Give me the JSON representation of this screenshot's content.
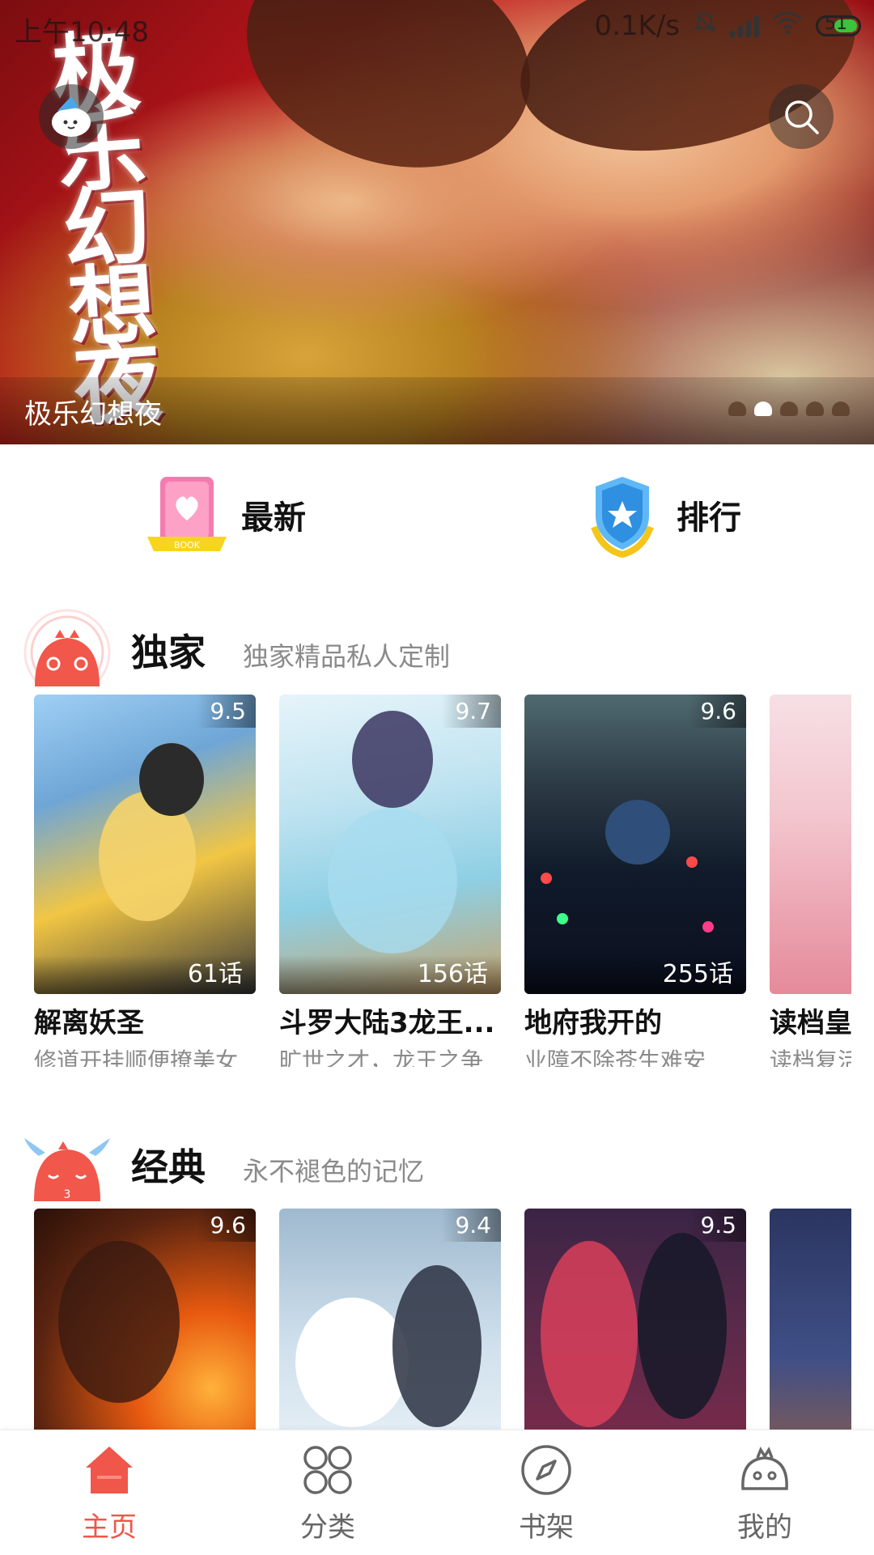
{
  "status_bar": {
    "time": "上午10:48",
    "net_speed": "0.1K/s",
    "battery": "51"
  },
  "banner": {
    "art_title": "极乐幻想夜",
    "caption": "极乐幻想夜",
    "dots": 5,
    "active_dot": 1
  },
  "quick_entries": {
    "new_label": "最新",
    "rank_label": "排行",
    "book_badge": "BOOK"
  },
  "sections": [
    {
      "title": "独家",
      "subtitle": "独家精品私人定制",
      "items": [
        {
          "score": "9.5",
          "eps": "61话",
          "name": "解离妖圣",
          "desc": "修道开挂顺便撩美女",
          "color": "#6fa6d6"
        },
        {
          "score": "9.7",
          "eps": "156话",
          "name": "斗罗大陆3龙王...",
          "desc": "旷世之才，龙王之争",
          "color": "#bfe3f0"
        },
        {
          "score": "9.6",
          "eps": "255话",
          "name": "地府我开的",
          "desc": "业障不除苍生难安",
          "color": "#1c2a3a"
        },
        {
          "score": "",
          "eps": "",
          "name": "读档皇",
          "desc": "读档复活",
          "color": "#f3c6cf"
        }
      ]
    },
    {
      "title": "经典",
      "subtitle": "永不褪色的记忆",
      "items": [
        {
          "score": "9.6",
          "eps": "",
          "name": "",
          "desc": "",
          "color": "#5a2410"
        },
        {
          "score": "9.4",
          "eps": "",
          "name": "",
          "desc": "",
          "color": "#cfe0ec"
        },
        {
          "score": "9.5",
          "eps": "",
          "name": "",
          "desc": "",
          "color": "#5b2a4a"
        },
        {
          "score": "",
          "eps": "",
          "name": "",
          "desc": "",
          "color": "#2b3560"
        }
      ]
    }
  ],
  "bottom_nav": [
    {
      "label": "主页",
      "icon": "home-icon",
      "active": true
    },
    {
      "label": "分类",
      "icon": "category-grid-icon",
      "active": false
    },
    {
      "label": "书架",
      "icon": "compass-icon",
      "active": false
    },
    {
      "label": "我的",
      "icon": "mascot-face-icon",
      "active": false
    }
  ],
  "colors": {
    "accent": "#f0564a",
    "muted_text": "#8a8a8a"
  }
}
